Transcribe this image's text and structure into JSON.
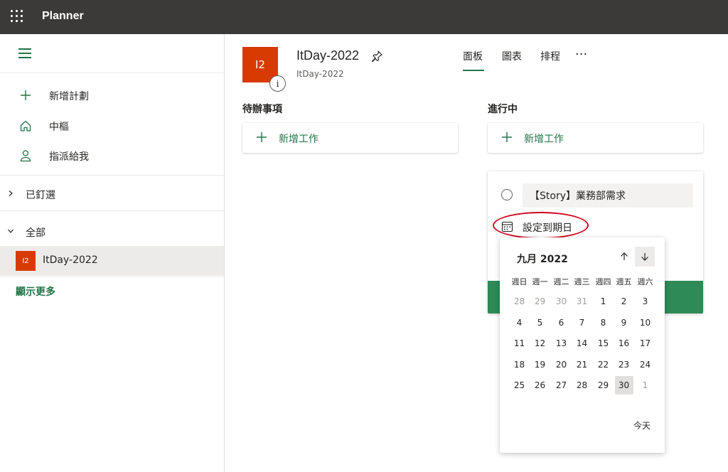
{
  "app": {
    "title": "Planner"
  },
  "sidebar": {
    "nav": [
      {
        "label": "新增計劃",
        "icon": "plus-icon"
      },
      {
        "label": "中樞",
        "icon": "home-icon"
      },
      {
        "label": "指派給我",
        "icon": "person-icon"
      }
    ],
    "pinned_label": "已釘選",
    "all_label": "全部",
    "plan": {
      "badge": "I2",
      "name": "ItDay-2022"
    },
    "show_more": "顯示更多"
  },
  "header": {
    "avatar": "I2",
    "info": "i",
    "title": "ItDay-2022",
    "subtitle": "ItDay-2022",
    "tabs": [
      {
        "label": "面板",
        "active": true
      },
      {
        "label": "圖表",
        "active": false
      },
      {
        "label": "排程",
        "active": false
      }
    ],
    "more": "···"
  },
  "buckets": [
    {
      "title": "待辦事項",
      "add_task": "新增工作"
    },
    {
      "title": "進行中",
      "add_task": "新增工作"
    }
  ],
  "task_card": {
    "name_value": "【Story】業務部需求",
    "due_label": "設定到期日"
  },
  "datepicker": {
    "month": "九月 2022",
    "weekdays": [
      "週日",
      "週一",
      "週二",
      "週三",
      "週四",
      "週五",
      "週六"
    ],
    "weeks": [
      [
        {
          "d": "28",
          "out": true
        },
        {
          "d": "29",
          "out": true
        },
        {
          "d": "30",
          "out": true
        },
        {
          "d": "31",
          "out": true
        },
        {
          "d": "1"
        },
        {
          "d": "2"
        },
        {
          "d": "3"
        }
      ],
      [
        {
          "d": "4"
        },
        {
          "d": "5"
        },
        {
          "d": "6"
        },
        {
          "d": "7"
        },
        {
          "d": "8"
        },
        {
          "d": "9"
        },
        {
          "d": "10"
        }
      ],
      [
        {
          "d": "11"
        },
        {
          "d": "12"
        },
        {
          "d": "13"
        },
        {
          "d": "14"
        },
        {
          "d": "15"
        },
        {
          "d": "16"
        },
        {
          "d": "17"
        }
      ],
      [
        {
          "d": "18"
        },
        {
          "d": "19"
        },
        {
          "d": "20"
        },
        {
          "d": "21"
        },
        {
          "d": "22"
        },
        {
          "d": "23"
        },
        {
          "d": "24"
        }
      ],
      [
        {
          "d": "25"
        },
        {
          "d": "26"
        },
        {
          "d": "27"
        },
        {
          "d": "28"
        },
        {
          "d": "29"
        },
        {
          "d": "30",
          "today": true
        },
        {
          "d": "1",
          "out": true
        }
      ]
    ],
    "today_label": "今天"
  },
  "colors": {
    "topbar": "#3b3a39",
    "accent_green": "#217346",
    "plan_orange": "#d83b01",
    "annotation_red": "#d0021b"
  }
}
